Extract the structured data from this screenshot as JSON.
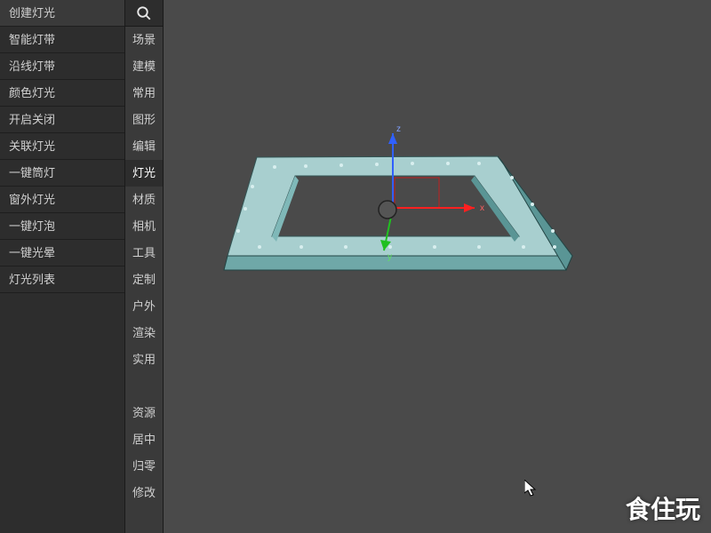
{
  "left_panel": {
    "items": [
      "创建灯光",
      "智能灯带",
      "沿线灯带",
      "颜色灯光",
      "开启关闭",
      "关联灯光",
      "一键筒灯",
      "窗外灯光",
      "一键灯泡",
      "一键光晕",
      "灯光列表"
    ]
  },
  "cat_panel": {
    "active_index": 5,
    "groups": [
      [
        "场景",
        "建模",
        "常用",
        "图形",
        "编辑",
        "灯光",
        "材质",
        "相机",
        "工具",
        "定制",
        "户外",
        "渲染",
        "实用"
      ],
      [
        "资源",
        "居中",
        "归零",
        "修改"
      ]
    ]
  },
  "gizmo": {
    "axis_labels": {
      "x": "x",
      "y": "y",
      "z": "z"
    }
  },
  "watermark": "食住玩",
  "icons": {
    "search": "search-icon",
    "cursor": "cursor-arrow"
  }
}
